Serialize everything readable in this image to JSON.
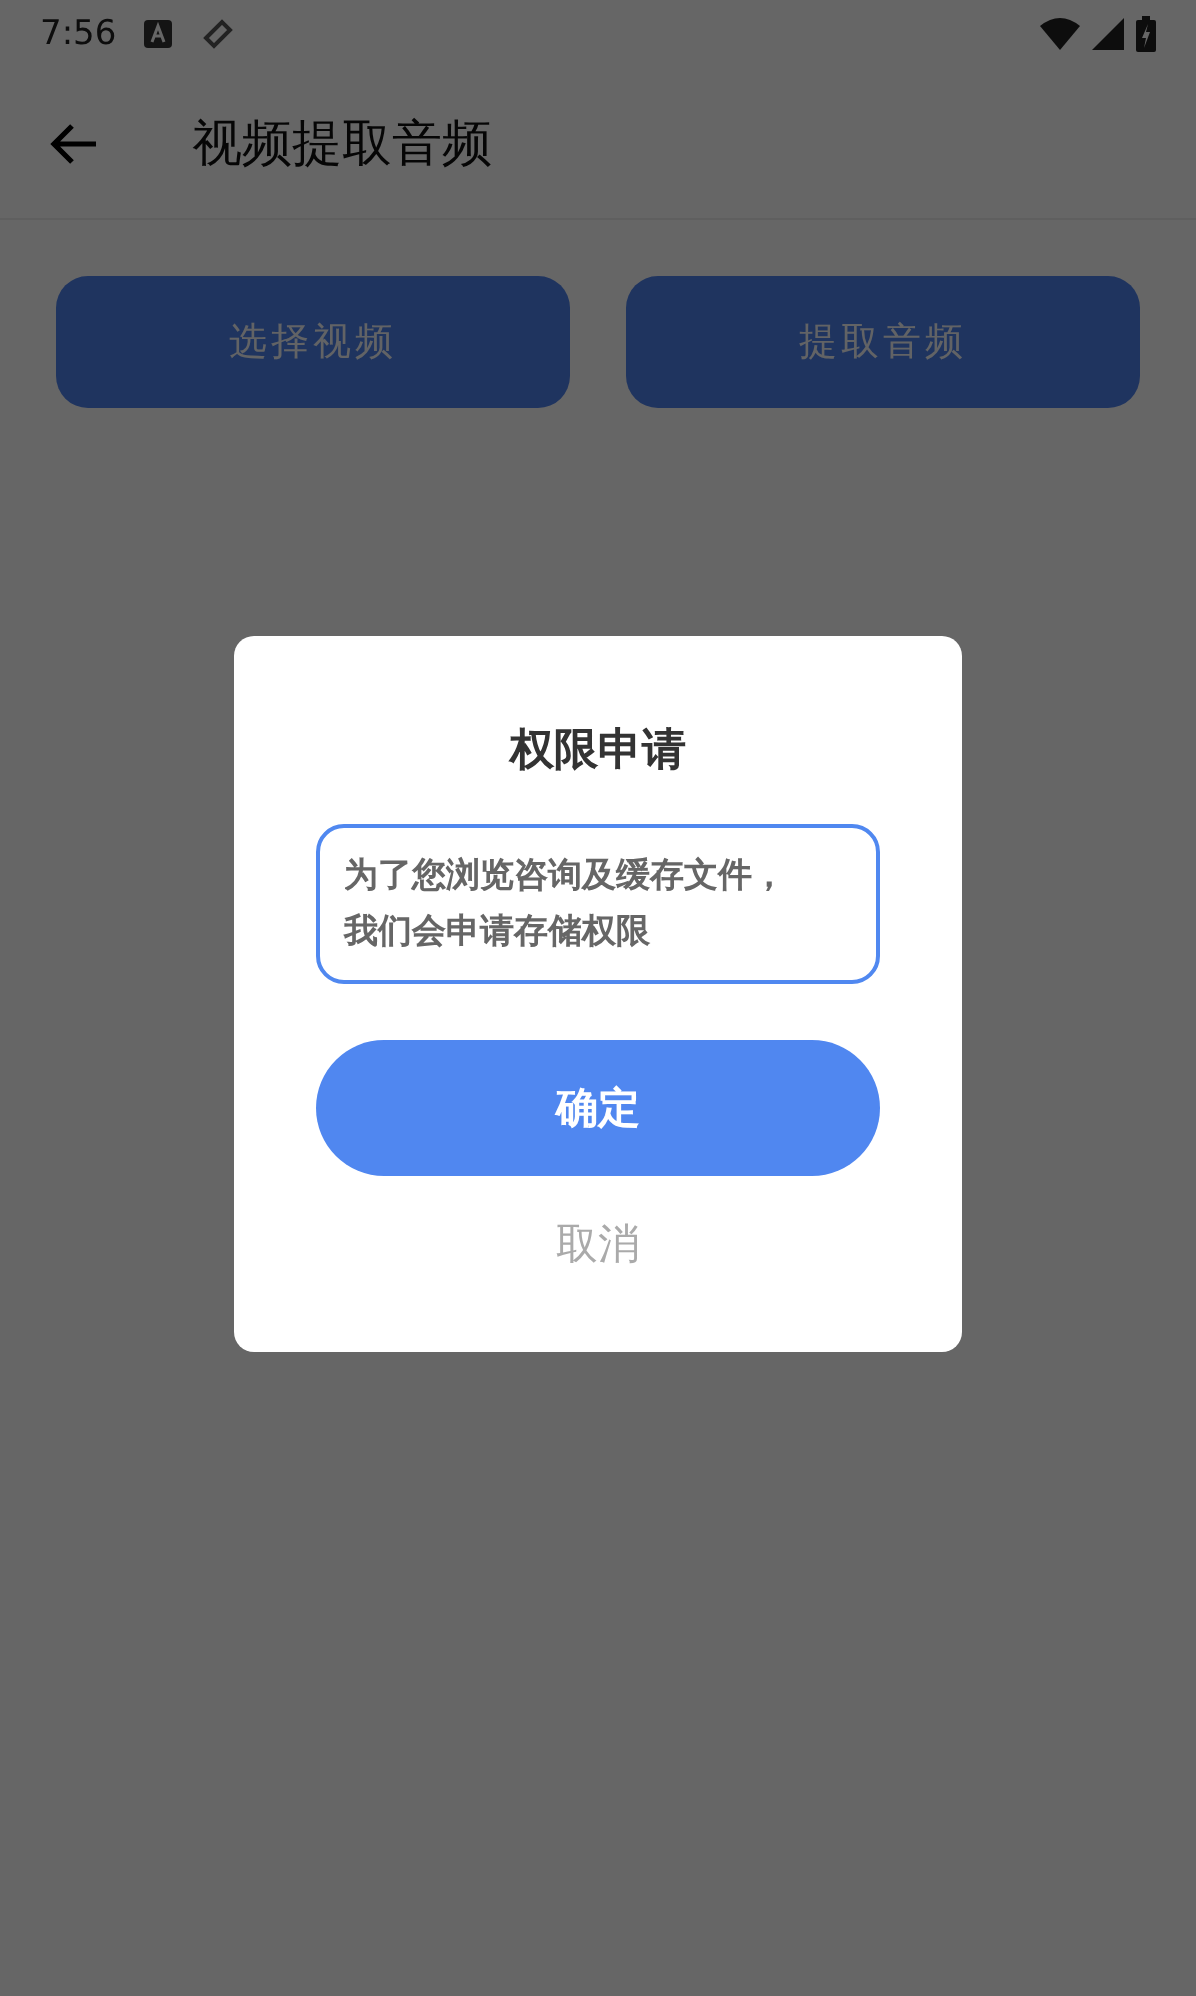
{
  "status_bar": {
    "time": "7:56"
  },
  "app_bar": {
    "title": "视频提取音频"
  },
  "buttons": [
    {
      "label": "选择视频"
    },
    {
      "label": "提取音频"
    }
  ],
  "dialog": {
    "title": "权限申请",
    "message": "为了您浏览咨询及缓存文件，我们会申请存储权限",
    "confirm": "确定",
    "cancel": "取消"
  }
}
